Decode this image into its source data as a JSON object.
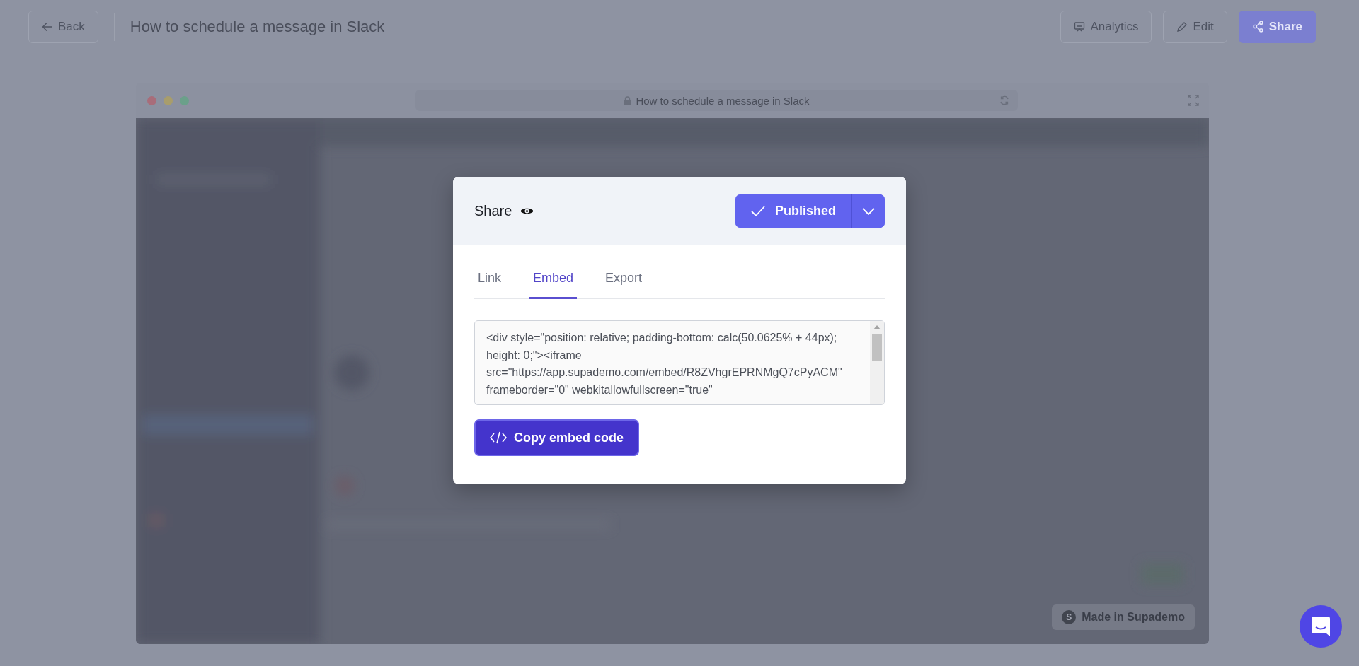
{
  "topbar": {
    "back": "Back",
    "title": "How to schedule a message in Slack",
    "buttons": [
      {
        "label": "Analytics",
        "kind": "analytics"
      },
      {
        "label": "Edit",
        "kind": "edit"
      },
      {
        "label": "Share",
        "kind": "share"
      }
    ]
  },
  "browser": {
    "address": "How to schedule a message in Slack",
    "badge": "Made in Supademo",
    "badge_logo": "S"
  },
  "modal": {
    "title": "Share",
    "status": "Published",
    "tabs": [
      {
        "label": "Link",
        "selected": false
      },
      {
        "label": "Embed",
        "selected": true
      },
      {
        "label": "Export",
        "selected": false
      }
    ],
    "embed_code": "<div style=\"position: relative; padding-bottom: calc(50.0625% + 44px); height: 0;\"><iframe src=\"https://app.supademo.com/embed/R8ZVhgrEPRNMgQ7cPyACM\" frameborder=\"0\" webkitallowfullscreen=\"true\"",
    "copy_button": "Copy embed code"
  }
}
